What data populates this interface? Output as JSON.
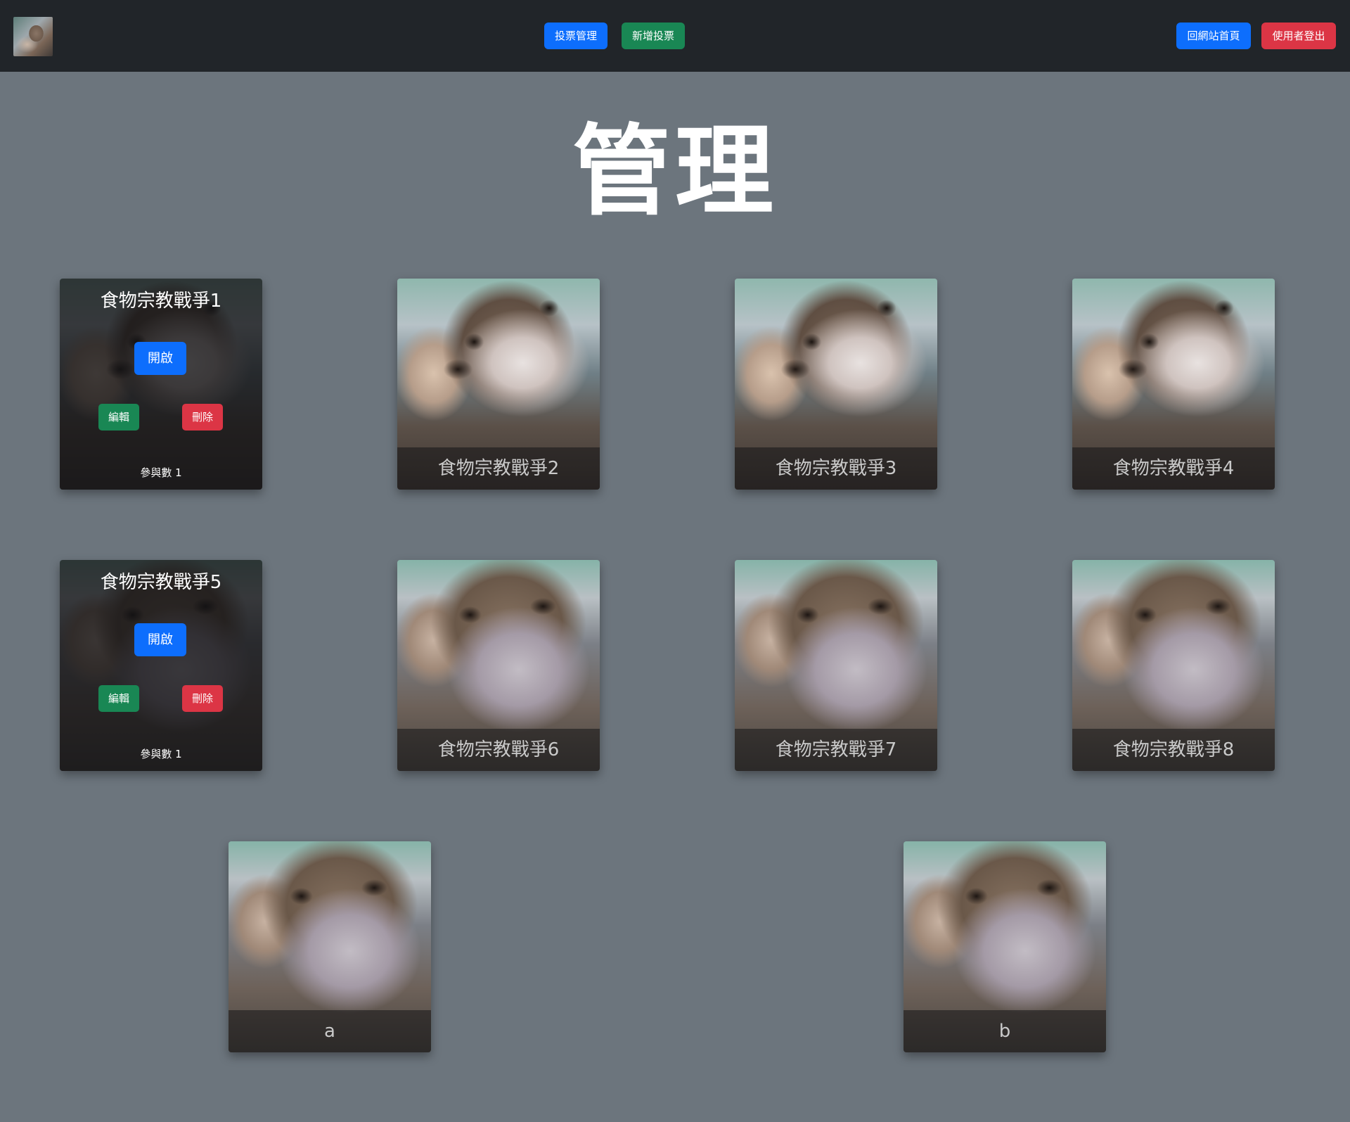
{
  "navbar": {
    "logo_alt": "otter avatar",
    "vote_manage_label": "投票管理",
    "add_vote_label": "新增投票",
    "home_label": "回網站首頁",
    "logout_label": "使用者登出"
  },
  "page": {
    "title": "管理"
  },
  "cards": [
    {
      "title": "食物宗教戰爭1",
      "active": true,
      "open_label": "開啟",
      "edit_label": "編輯",
      "delete_label": "刪除",
      "participants_label": "參與數 1"
    },
    {
      "title": "食物宗教戰爭2"
    },
    {
      "title": "食物宗教戰爭3"
    },
    {
      "title": "食物宗教戰爭4"
    },
    {
      "title": "食物宗教戰爭5",
      "active": true,
      "open_label": "開啟",
      "edit_label": "編輯",
      "delete_label": "刪除",
      "participants_label": "參與數 1"
    },
    {
      "title": "食物宗教戰爭6"
    },
    {
      "title": "食物宗教戰爭7"
    },
    {
      "title": "食物宗教戰爭8"
    },
    {
      "title": "a"
    },
    {
      "title": "b"
    }
  ],
  "colors": {
    "navbar_bg": "#212529",
    "page_bg": "#6c757d",
    "primary": "#0d6efd",
    "success": "#198754",
    "danger": "#dc3545"
  }
}
